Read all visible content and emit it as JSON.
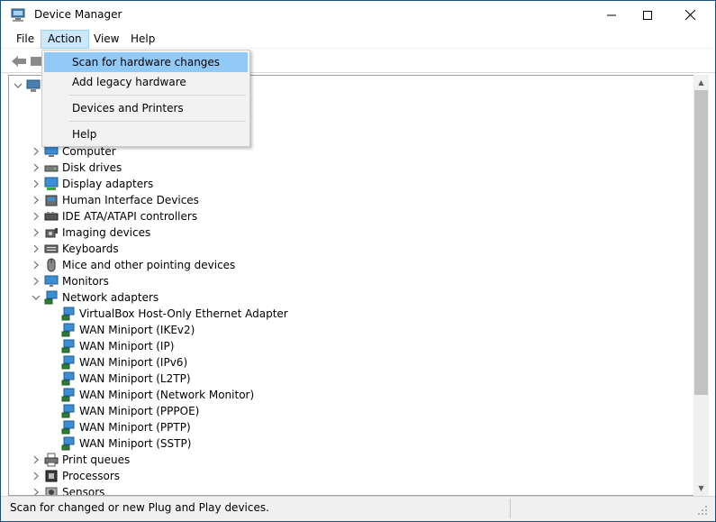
{
  "window": {
    "title": "Device Manager",
    "controls": [
      "minimize",
      "maximize",
      "close"
    ]
  },
  "menubar": {
    "items": [
      {
        "label": "File"
      },
      {
        "label": "Action",
        "active": true
      },
      {
        "label": "View"
      },
      {
        "label": "Help"
      }
    ]
  },
  "action_menu": {
    "items": [
      {
        "label": "Scan for hardware changes",
        "highlighted": true
      },
      {
        "label": "Add legacy hardware"
      },
      {
        "label": "Devices and Printers"
      },
      {
        "label": "Help"
      }
    ]
  },
  "tree": {
    "rows": [
      {
        "label": "Computer",
        "icon": "computer-icon",
        "expander": "collapsed"
      },
      {
        "label": "Disk drives",
        "icon": "disk-drive-icon",
        "expander": "collapsed"
      },
      {
        "label": "Display adapters",
        "icon": "display-adapter-icon",
        "expander": "collapsed"
      },
      {
        "label": "Human Interface Devices",
        "icon": "hid-icon",
        "expander": "collapsed"
      },
      {
        "label": "IDE ATA/ATAPI controllers",
        "icon": "ide-controller-icon",
        "expander": "collapsed"
      },
      {
        "label": "Imaging devices",
        "icon": "camera-icon",
        "expander": "collapsed"
      },
      {
        "label": "Keyboards",
        "icon": "keyboard-icon",
        "expander": "collapsed"
      },
      {
        "label": "Mice and other pointing devices",
        "icon": "mouse-icon",
        "expander": "collapsed"
      },
      {
        "label": "Monitors",
        "icon": "monitor-icon",
        "expander": "collapsed"
      },
      {
        "label": "Network adapters",
        "icon": "network-adapter-icon",
        "expander": "expanded"
      },
      {
        "label": "VirtualBox Host-Only Ethernet Adapter",
        "icon": "network-adapter-icon",
        "child": true
      },
      {
        "label": "WAN Miniport (IKEv2)",
        "icon": "network-adapter-icon",
        "child": true
      },
      {
        "label": "WAN Miniport (IP)",
        "icon": "network-adapter-icon",
        "child": true
      },
      {
        "label": "WAN Miniport (IPv6)",
        "icon": "network-adapter-icon",
        "child": true
      },
      {
        "label": "WAN Miniport (L2TP)",
        "icon": "network-adapter-icon",
        "child": true
      },
      {
        "label": "WAN Miniport (Network Monitor)",
        "icon": "network-adapter-icon",
        "child": true
      },
      {
        "label": "WAN Miniport (PPPOE)",
        "icon": "network-adapter-icon",
        "child": true
      },
      {
        "label": "WAN Miniport (PPTP)",
        "icon": "network-adapter-icon",
        "child": true
      },
      {
        "label": "WAN Miniport (SSTP)",
        "icon": "network-adapter-icon",
        "child": true
      },
      {
        "label": "Print queues",
        "icon": "printer-icon",
        "expander": "collapsed"
      },
      {
        "label": "Processors",
        "icon": "processor-icon",
        "expander": "collapsed"
      },
      {
        "label": "Sensors",
        "icon": "sensor-icon",
        "expander": "collapsed"
      }
    ]
  },
  "statusbar": {
    "text": "Scan for changed or new Plug and Play devices."
  },
  "colors": {
    "menu_active_bg": "#cce8ff",
    "menu_highlight_bg": "#91c9f7",
    "network_icon": "#2e8fd8"
  }
}
